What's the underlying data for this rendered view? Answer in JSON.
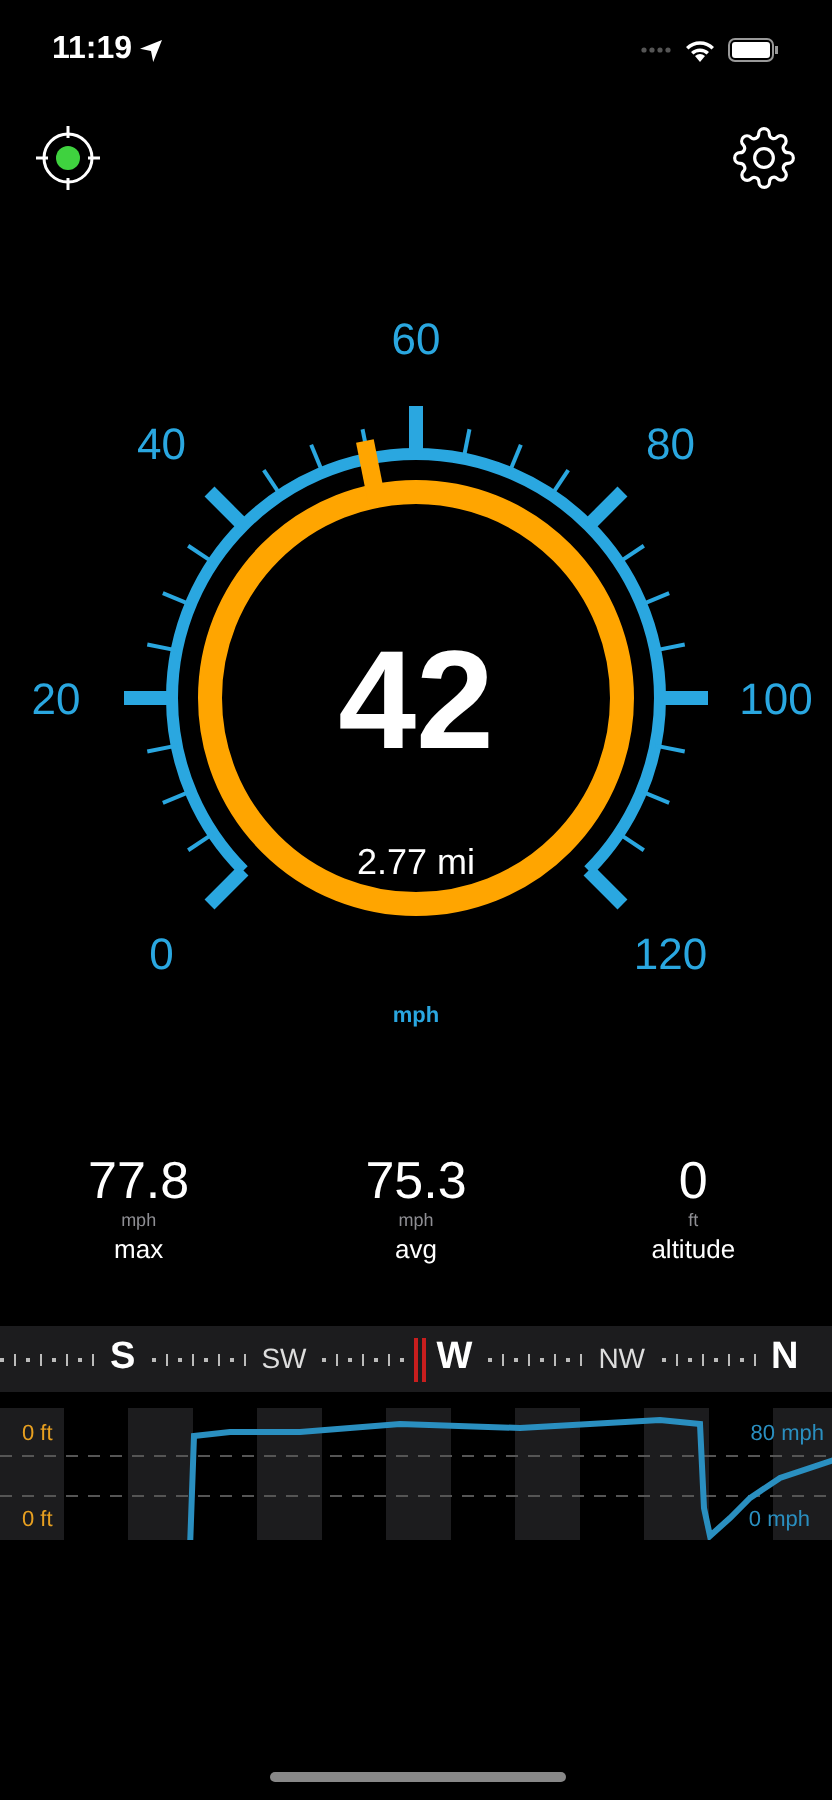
{
  "status_bar": {
    "time": "11:19"
  },
  "gauge": {
    "speed": "42",
    "distance": "2.77 mi",
    "unit": "mph",
    "scale_labels": [
      "0",
      "20",
      "40",
      "60",
      "80",
      "100",
      "120"
    ]
  },
  "stats": [
    {
      "value": "77.8",
      "unit": "mph",
      "label": "max"
    },
    {
      "value": "75.3",
      "unit": "mph",
      "label": "avg"
    },
    {
      "value": "0",
      "unit": "ft",
      "label": "altitude"
    }
  ],
  "compass": [
    {
      "label": "S",
      "kind": "cardinal"
    },
    {
      "label": "SW",
      "kind": "intercardinal"
    },
    {
      "label": "W",
      "kind": "cardinal"
    },
    {
      "label": "NW",
      "kind": "intercardinal"
    },
    {
      "label": "N",
      "kind": "cardinal"
    }
  ],
  "history": {
    "altitude_top": "0 ft",
    "altitude_bottom": "0 ft",
    "speed_top": "80 mph",
    "speed_bottom": "0 mph"
  }
}
